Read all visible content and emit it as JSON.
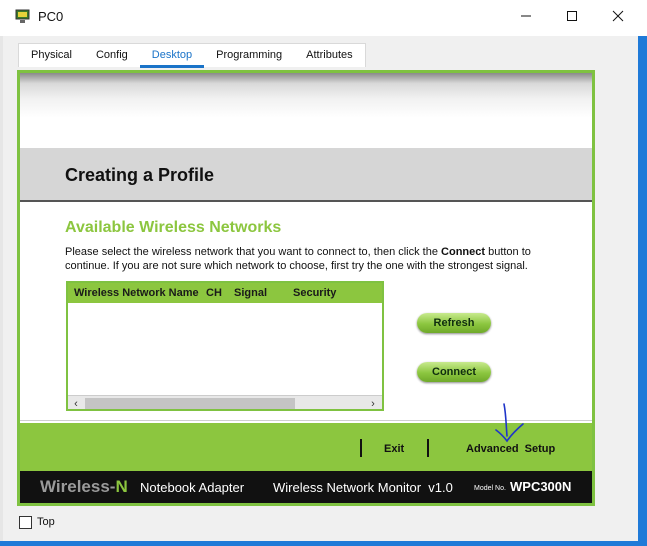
{
  "window": {
    "title": "PC0"
  },
  "tabs": [
    "Physical",
    "Config",
    "Desktop",
    "Programming",
    "Attributes"
  ],
  "profile": {
    "title": "Creating a Profile"
  },
  "networks": {
    "title": "Available Wireless Networks",
    "desc_before": "Please select the wireless network that you want to connect to, then click the ",
    "desc_bold": "Connect",
    "desc_after": " button to continue. If you are not sure which network to choose, first try the one with the strongest signal.",
    "columns": [
      "Wireless Network Name",
      "CH",
      "Signal",
      "Security"
    ]
  },
  "buttons": {
    "refresh": "Refresh",
    "connect": "Connect"
  },
  "footer": {
    "exit": "Exit",
    "advanced_setup": "Advanced  Setup"
  },
  "brand": {
    "wireless": "Wireless-",
    "n": "N",
    "notebook": "Notebook Adapter",
    "monitor": "Wireless Network Monitor  v1.0",
    "model_no": "Model No.",
    "model": "WPC300N"
  },
  "options": {
    "top_label": "Top",
    "top_checked": false
  },
  "colors": {
    "accent_green": "#8cc63f",
    "tab_active": "#1a73c8",
    "window_border": "#1f7ad8"
  }
}
